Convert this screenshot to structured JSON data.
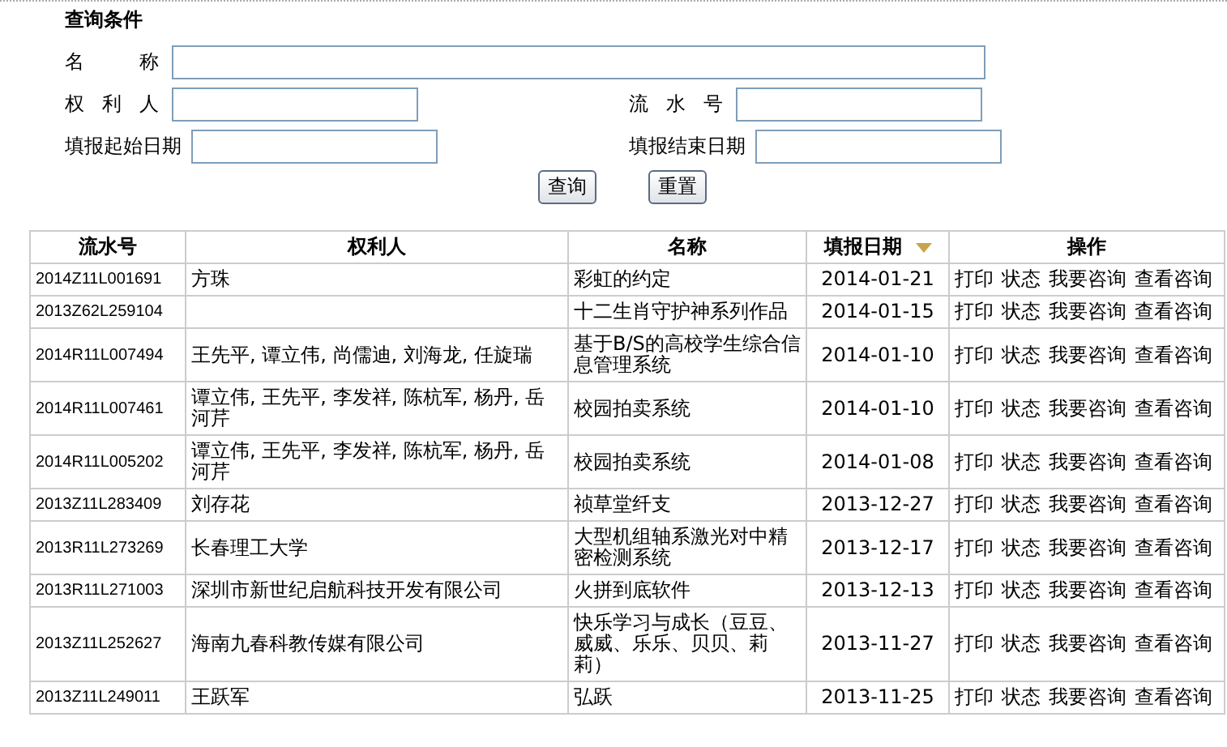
{
  "query_panel": {
    "title": "查询条件",
    "fields": [
      {
        "label": "名称"
      },
      {
        "label": "权利人"
      },
      {
        "label": "流水号"
      },
      {
        "label": "填报起始日期"
      },
      {
        "label": "填报结束日期"
      }
    ],
    "buttons": [
      "查询",
      "重置"
    ]
  },
  "table": {
    "columns": [
      {
        "label": "流水号",
        "sorted": false
      },
      {
        "label": "权利人",
        "sorted": false
      },
      {
        "label": "名称",
        "sorted": false
      },
      {
        "label": "填报日期",
        "sorted": true
      },
      {
        "label": "操作",
        "sorted": false
      }
    ],
    "rows": [
      {
        "serial": "2014Z11L001691",
        "owner": "方珠",
        "name": "彩虹的约定",
        "date": "2014-01-21",
        "actions": [
          "打印",
          "状态",
          "我要咨询",
          "查看咨询"
        ]
      },
      {
        "serial": "2013Z62L259104",
        "owner": "",
        "name": "十二生肖守护神系列作品",
        "date": "2014-01-15",
        "actions": [
          "打印",
          "状态",
          "我要咨询",
          "查看咨询"
        ]
      },
      {
        "serial": "2014R11L007494",
        "owner": "王先平, 谭立伟, 尚儒迪, 刘海龙, 任旋瑞",
        "name": "基于B/S的高校学生综合信息管理系统",
        "date": "2014-01-10",
        "actions": [
          "打印",
          "状态",
          "我要咨询",
          "查看咨询"
        ]
      },
      {
        "serial": "2014R11L007461",
        "owner": "谭立伟, 王先平, 李发祥, 陈杭军, 杨丹, 岳河芹",
        "name": "校园拍卖系统",
        "date": "2014-01-10",
        "actions": [
          "打印",
          "状态",
          "我要咨询",
          "查看咨询"
        ]
      },
      {
        "serial": "2014R11L005202",
        "owner": "谭立伟, 王先平, 李发祥, 陈杭军, 杨丹, 岳河芹",
        "name": "校园拍卖系统",
        "date": "2014-01-08",
        "actions": [
          "打印",
          "状态",
          "我要咨询",
          "查看咨询"
        ]
      },
      {
        "serial": "2013Z11L283409",
        "owner": "刘存花",
        "name": "祯草堂纤支",
        "date": "2013-12-27",
        "actions": [
          "打印",
          "状态",
          "我要咨询",
          "查看咨询"
        ]
      },
      {
        "serial": "2013R11L273269",
        "owner": "长春理工大学",
        "name": "大型机组轴系激光对中精密检测系统",
        "date": "2013-12-17",
        "actions": [
          "打印",
          "状态",
          "我要咨询",
          "查看咨询"
        ]
      },
      {
        "serial": "2013R11L271003",
        "owner": "深圳市新世纪启航科技开发有限公司",
        "name": "火拼到底软件",
        "date": "2013-12-13",
        "actions": [
          "打印",
          "状态",
          "我要咨询",
          "查看咨询"
        ]
      },
      {
        "serial": "2013Z11L252627",
        "owner": "海南九春科教传媒有限公司",
        "name": "快乐学习与成长（豆豆、威威、乐乐、贝贝、莉莉）",
        "date": "2013-11-27",
        "actions": [
          "打印",
          "状态",
          "我要咨询",
          "查看咨询"
        ]
      },
      {
        "serial": "2013Z11L249011",
        "owner": "王跃军",
        "name": "弘跃",
        "date": "2013-11-25",
        "actions": [
          "打印",
          "状态",
          "我要咨询",
          "查看咨询"
        ]
      }
    ]
  }
}
